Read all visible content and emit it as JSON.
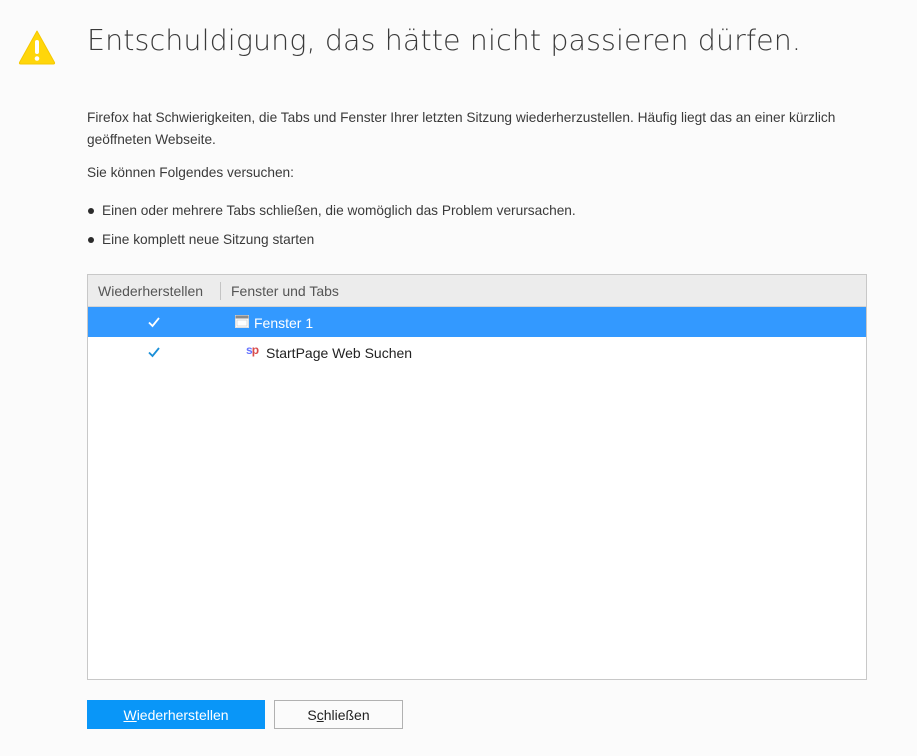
{
  "title": "Entschuldigung, das hätte nicht passieren dürfen.",
  "description": "Firefox hat Schwierigkeiten, die Tabs und Fenster Ihrer letzten Sitzung wiederherzustellen. Häufig liegt das an einer kürzlich geöffneten Webseite.",
  "try_heading": "Sie können Folgendes versuchen:",
  "suggestions": [
    "Einen oder mehrere Tabs schließen, die womöglich das Problem verursachen.",
    "Eine komplett neue Sitzung starten"
  ],
  "tree": {
    "columns": {
      "restore": "Wiederherstellen",
      "windows_tabs": "Fenster und Tabs"
    },
    "rows": [
      {
        "label": "Fenster 1",
        "checked": true,
        "selected": true,
        "icon": "window-icon"
      },
      {
        "label": "StartPage Web Suchen",
        "checked": true,
        "selected": false,
        "icon": "startpage-favicon"
      }
    ]
  },
  "buttons": {
    "restore_access_key": "W",
    "restore_rest": "iederherstellen",
    "close_prefix": "S",
    "close_access_key": "c",
    "close_rest": "hließen"
  },
  "colors": {
    "accent": "#0996f8",
    "selection": "#3399ff",
    "warning": "#ffd60a"
  }
}
